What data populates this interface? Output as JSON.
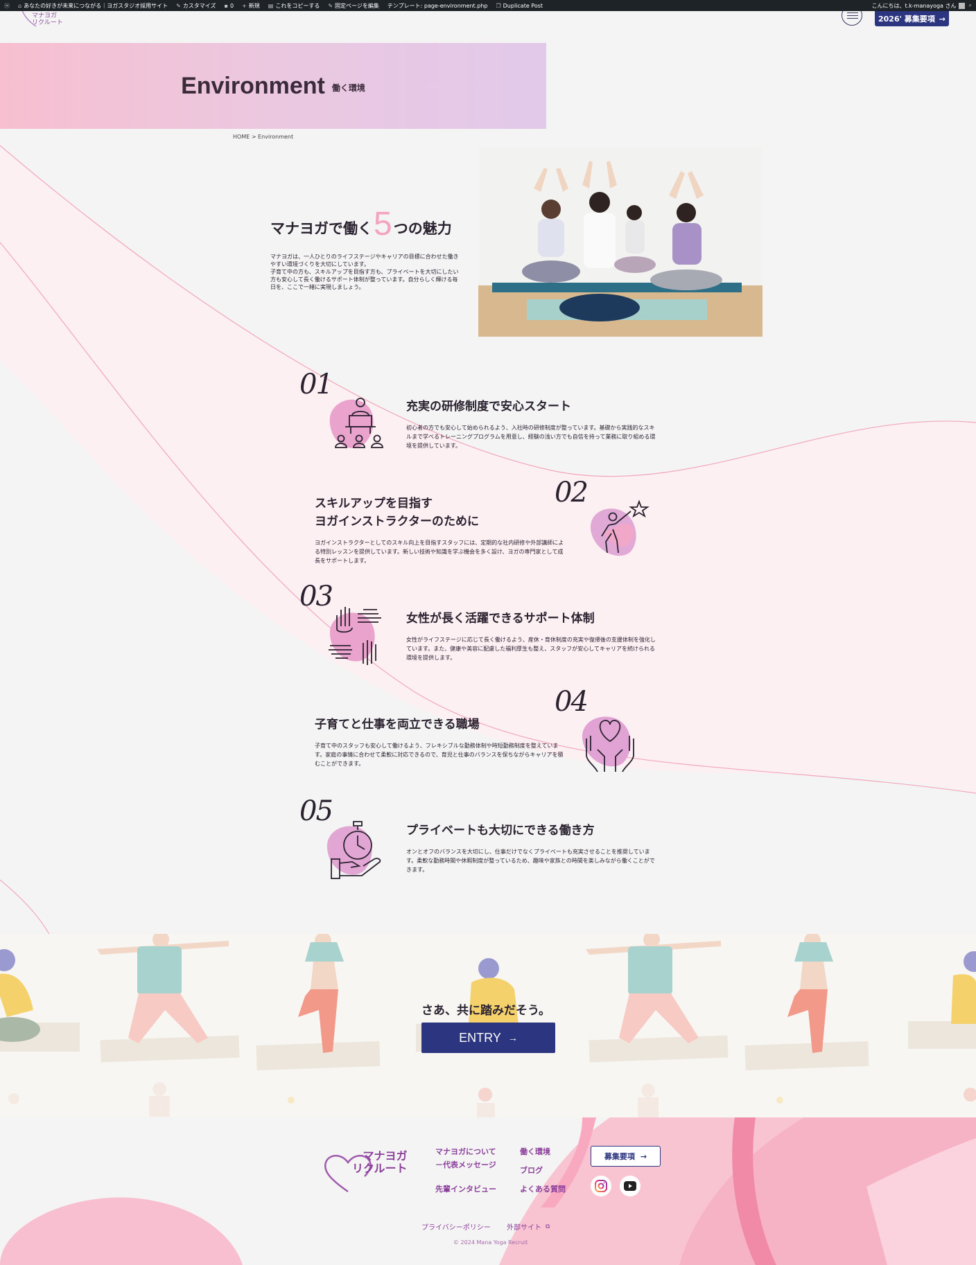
{
  "admin_bar": {
    "site_name": "あなたの好きが未来につながる｜ヨガスタジオ採用サイト",
    "customize": "カスタマイズ",
    "comments": "0",
    "new": "新規",
    "copy": "これをコピーする",
    "edit_page": "固定ページを編集",
    "template": "テンプレート: page-environment.php",
    "duplicate": "Duplicate Post",
    "greeting": "こんにちは、t.k-manayoga さん"
  },
  "header": {
    "logo_line1": "マナヨガ",
    "logo_line2": "リクルート",
    "recruit_button": "2026' 募集要項",
    "recruit_arrow": "→"
  },
  "hero": {
    "title": "Environment",
    "subtitle": "働く環境"
  },
  "breadcrumb": "HOME > Environment",
  "intro": {
    "title_before": "マナヨガで働く",
    "title_number": "5",
    "title_after": "つの魅力",
    "paragraph1": "マナヨガは、一人ひとりのライフステージやキャリアの目標に合わせた働きやすい環境づくりを大切にしています。",
    "paragraph2": "子育て中の方も、スキルアップを目指す方も、プライベートを大切にしたい方も安心して長く働けるサポート体制が整っています。自分らしく輝ける毎日を、ここで一緒に実現しましょう。"
  },
  "features": [
    {
      "number": "01",
      "title": "充実の研修制度で安心スタート",
      "text": "初心者の方でも安心して始められるよう、入社時の研修制度が整っています。基礎から実践的なスキルまで学べるトレーニングプログラムを用意し、経験の浅い方でも自信を持って業務に取り組める環境を提供しています。",
      "icon": "training-icon"
    },
    {
      "number": "02",
      "title_line1": "スキルアップを目指す",
      "title_line2": "ヨガインストラクターのために",
      "text": "ヨガインストラクターとしてのスキル向上を目指すスタッフには、定期的な社内研修や外部講師による特別レッスンを提供しています。新しい技術や知識を学ぶ機会を多く設け、ヨガの専門家として成長をサポートします。",
      "icon": "skill-up-icon"
    },
    {
      "number": "03",
      "title": "女性が長く活躍できるサポート体制",
      "text": "女性がライフステージに応じて長く働けるよう、産休・育休制度の充実や復帰後の支援体制を強化しています。また、健康や美容に配慮した福利厚生も整え、スタッフが安心してキャリアを続けられる環境を提供します。",
      "icon": "support-hands-icon"
    },
    {
      "number": "04",
      "title": "子育てと仕事を両立できる職場",
      "text": "子育て中のスタッフも安心して働けるよう、フレキシブルな勤務体制や時短勤務制度を整えています。家庭の事情に合わせて柔軟に対応できるので、育児と仕事のバランスを保ちながらキャリアを積むことができます。",
      "icon": "heart-hands-icon"
    },
    {
      "number": "05",
      "title": "プライベートも大切にできる働き方",
      "text": "オンとオフのバランスを大切にし、仕事だけでなくプライベートも充実させることを推奨しています。柔軟な勤務時間や休暇制度が整っているため、趣味や家族との時間を楽しみながら働くことができます。",
      "icon": "stopwatch-hand-icon"
    }
  ],
  "cta": {
    "title": "さあ、共に踏みだそう。",
    "entry_label": "ENTRY",
    "entry_arrow": "→"
  },
  "footer": {
    "logo_line1": "マナヨガ",
    "logo_line2": "リクルート",
    "links": {
      "about_line1": "マナヨガについて",
      "about_line2": "－代表メッセージ",
      "interview": "先輩インタビュー",
      "environment": "働く環境",
      "blog": "ブログ",
      "faq": "よくある質問"
    },
    "recruit_button": "募集要項",
    "recruit_arrow": "→",
    "privacy": "プライバシーポリシー",
    "external": "外部サイト",
    "copyright": "© 2024 Mana Yoga Recruit"
  },
  "colors": {
    "navy": "#2c3580",
    "pink": "#f4a3c0",
    "purple": "#8a3f9a"
  }
}
